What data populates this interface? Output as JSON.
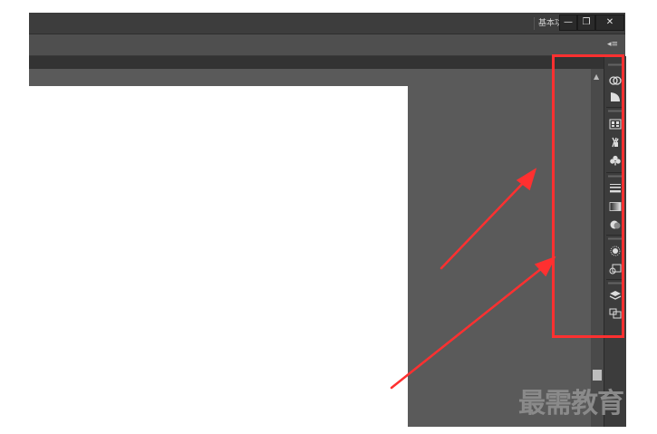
{
  "titlebar": {
    "workspace_label": "基本功能",
    "workspace_caret": "▾",
    "minimize": "—",
    "restore": "❐",
    "close": "✕"
  },
  "optionsbar": {
    "collapse_glyph": "◂≡"
  },
  "scroll": {
    "up": "▲"
  },
  "colors": {
    "highlight": "#ff3030",
    "chrome_dark": "#3d3d3d",
    "pasteboard": "#5a5a5a",
    "watermark": "#8a8a8a"
  },
  "panel_dock": {
    "icons": [
      "color-guide-icon",
      "gradient-wedge-icon",
      "swatches-icon",
      "brushes-icon",
      "symbols-icon",
      "stroke-icon",
      "gradient-icon",
      "transparency-icon",
      "appearance-icon",
      "graphic-styles-icon",
      "layers-icon",
      "artboards-icon"
    ]
  },
  "watermark": "最需教育"
}
